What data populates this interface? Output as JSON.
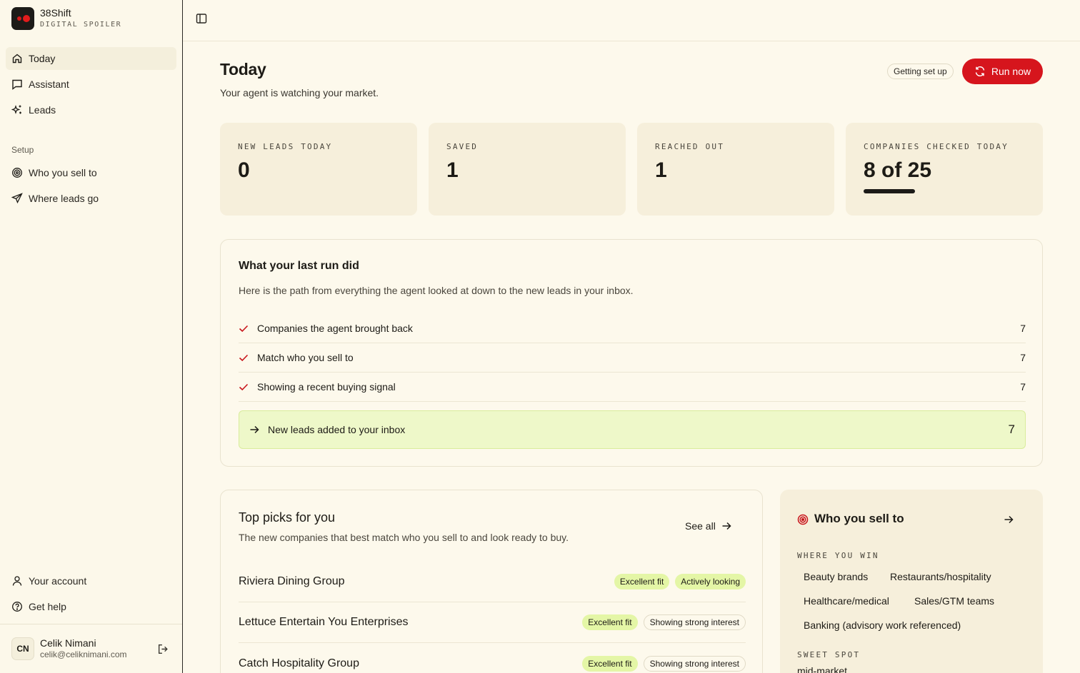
{
  "brand": {
    "name": "38Shift",
    "subtitle": "DIGITAL SPOILER"
  },
  "nav": {
    "items": [
      {
        "label": "Today",
        "icon": "home-icon",
        "active": true
      },
      {
        "label": "Assistant",
        "icon": "chat-icon"
      },
      {
        "label": "Leads",
        "icon": "sparkles-icon"
      }
    ],
    "setup_label": "Setup",
    "setup_items": [
      {
        "label": "Who you sell to",
        "icon": "target-icon"
      },
      {
        "label": "Where leads go",
        "icon": "send-icon"
      }
    ],
    "bottom_items": [
      {
        "label": "Your account",
        "icon": "user-icon"
      },
      {
        "label": "Get help",
        "icon": "help-icon"
      }
    ]
  },
  "user": {
    "initials": "CN",
    "name": "Celik Nimani",
    "email": "celik@celiknimani.com"
  },
  "page": {
    "title": "Today",
    "subtitle": "Your agent is watching your market.",
    "setup_badge": "Getting set up",
    "run_button": "Run now"
  },
  "stats": [
    {
      "label": "NEW LEADS TODAY",
      "value": "0"
    },
    {
      "label": "SAVED",
      "value": "1"
    },
    {
      "label": "REACHED OUT",
      "value": "1"
    },
    {
      "label": "COMPANIES CHECKED TODAY",
      "value": "8 of 25",
      "progress": 0.32
    }
  ],
  "last_run": {
    "title": "What your last run did",
    "subtitle": "Here is the path from everything the agent looked at down to the new leads in your inbox.",
    "steps": [
      {
        "label": "Companies the agent brought back",
        "value": "7"
      },
      {
        "label": "Match who you sell to",
        "value": "7"
      },
      {
        "label": "Showing a recent buying signal",
        "value": "7"
      }
    ],
    "final": {
      "label": "New leads added to your inbox",
      "value": "7"
    }
  },
  "top_picks": {
    "title": "Top picks for you",
    "subtitle": "The new companies that best match who you sell to and look ready to buy.",
    "see_all": "See all",
    "rows": [
      {
        "name": "Riviera Dining Group",
        "tags": [
          "Excellent fit",
          "Actively looking"
        ]
      },
      {
        "name": "Lettuce Entertain You Enterprises",
        "tags": [
          "Excellent fit",
          "Showing strong interest"
        ]
      },
      {
        "name": "Catch Hospitality Group",
        "tags": [
          "Excellent fit",
          "Showing strong interest"
        ]
      }
    ]
  },
  "icp": {
    "title": "Who you sell to",
    "where_label": "WHERE YOU WIN",
    "where": [
      "Beauty brands",
      "Restaurants/hospitality",
      "Healthcare/medical",
      "Sales/GTM teams",
      "Banking (advisory work referenced)"
    ],
    "sweet_label": "SWEET SPOT",
    "sweet": "mid-market"
  },
  "colors": {
    "accent": "#d6151d",
    "highlight": "#eef8c9",
    "tag_green": "#e4f6a6",
    "card": "#f6efdb",
    "background": "#fdf9ec"
  }
}
